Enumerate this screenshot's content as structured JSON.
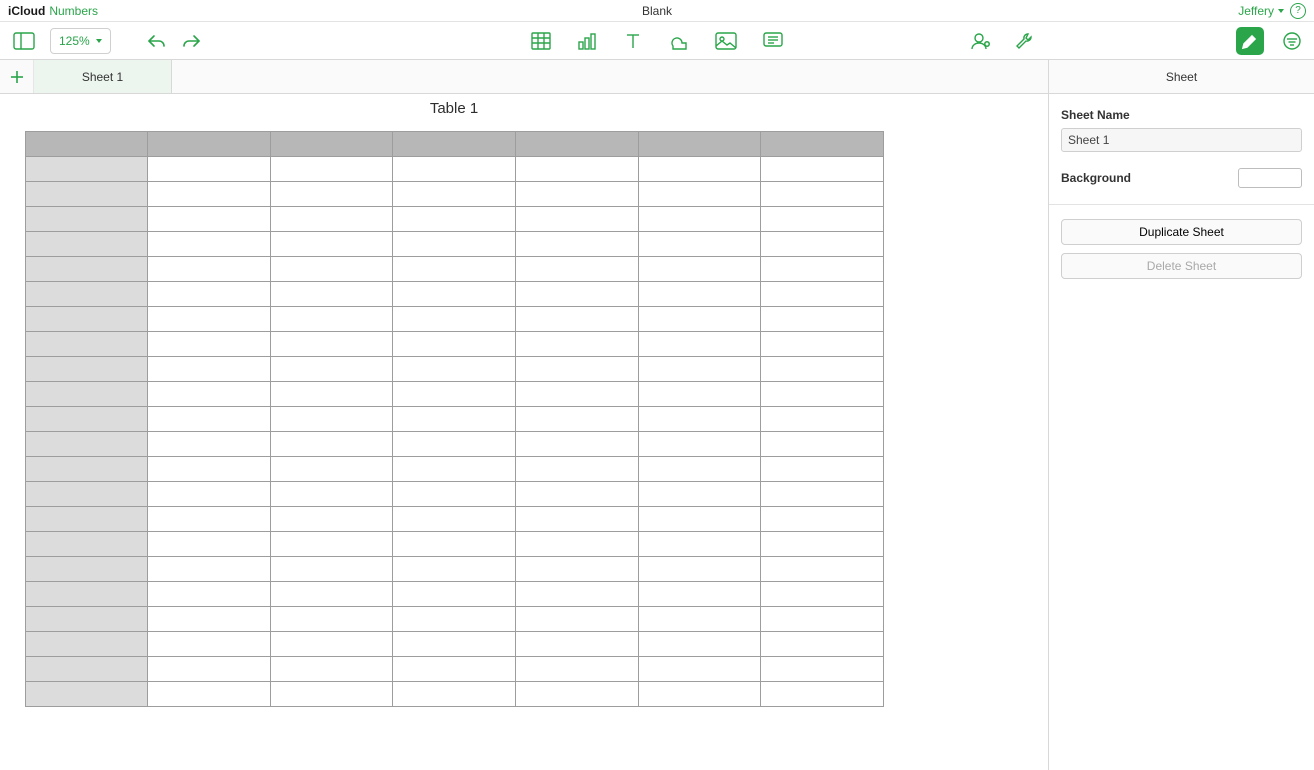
{
  "titlebar": {
    "brand_service": "iCloud",
    "brand_app": "Numbers",
    "document_title": "Blank",
    "user_name": "Jeffery",
    "help_glyph": "?"
  },
  "toolbar": {
    "zoom_value": "125%"
  },
  "sheets": {
    "tabs": [
      {
        "label": "Sheet 1"
      }
    ]
  },
  "canvas": {
    "table_title": "Table 1",
    "columns": 7,
    "body_rows": 22
  },
  "inspector": {
    "tab_label": "Sheet",
    "sheet_name_label": "Sheet Name",
    "sheet_name_value": "Sheet 1",
    "background_label": "Background",
    "background_color": "#ffffff",
    "duplicate_label": "Duplicate Sheet",
    "delete_label": "Delete Sheet"
  }
}
